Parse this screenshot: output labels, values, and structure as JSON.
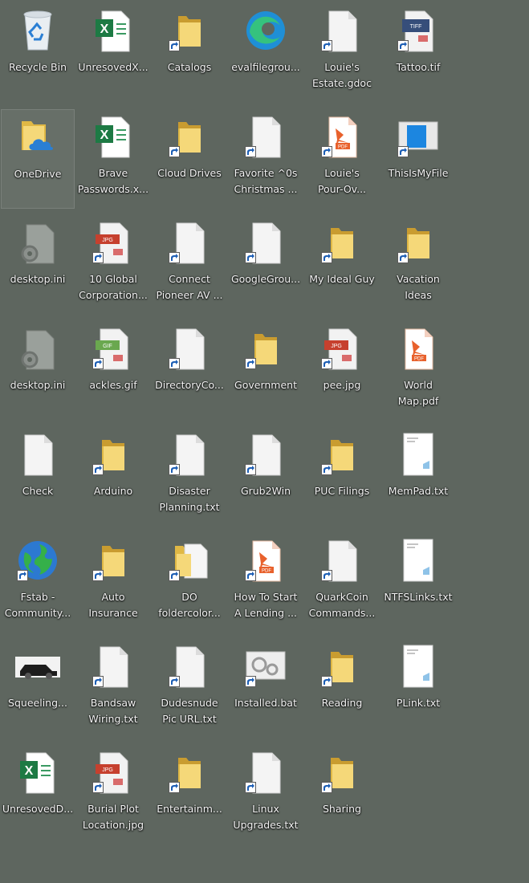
{
  "desktop": {
    "icons": [
      {
        "label": "Recycle Bin",
        "type": "recycle",
        "icon": "recycle-bin-icon",
        "shortcut": false,
        "name": "recycle-bin"
      },
      {
        "label": "UnresovedX...",
        "type": "excel",
        "icon": "excel-icon",
        "shortcut": false,
        "name": "unresovedx"
      },
      {
        "label": "Catalogs",
        "type": "folder",
        "icon": "folder-icon",
        "shortcut": true,
        "name": "catalogs"
      },
      {
        "label": "evalfilegrou...",
        "type": "edge",
        "icon": "edge-icon",
        "shortcut": false,
        "name": "evalfilegroup"
      },
      {
        "label": "Louie's\nEstate.gdoc",
        "type": "doc",
        "icon": "document-icon",
        "shortcut": true,
        "name": "louies-estate-gdoc"
      },
      {
        "label": "Tattoo.tif",
        "type": "tif",
        "icon": "tif-image-icon",
        "shortcut": true,
        "name": "tattoo-tif"
      },
      {
        "label": "OneDrive",
        "type": "onedrive",
        "icon": "onedrive-folder-icon",
        "shortcut": false,
        "name": "onedrive",
        "selected": true
      },
      {
        "label": "Brave\nPasswords.x...",
        "type": "excel",
        "icon": "excel-icon",
        "shortcut": false,
        "name": "brave-passwords"
      },
      {
        "label": "Cloud Drives",
        "type": "folder",
        "icon": "folder-icon",
        "shortcut": true,
        "name": "cloud-drives"
      },
      {
        "label": "Favorite ^0s\nChristmas ...",
        "type": "doc",
        "icon": "document-icon",
        "shortcut": true,
        "name": "favorite-christmas"
      },
      {
        "label": "Louie's\nPour-Ov...",
        "type": "pdf",
        "icon": "pdf-icon",
        "shortcut": true,
        "name": "louies-pour-over"
      },
      {
        "label": "ThisIsMyFile",
        "type": "window",
        "icon": "window-icon",
        "shortcut": true,
        "name": "thisismyfile"
      },
      {
        "label": "desktop.ini",
        "type": "ini",
        "icon": "settings-file-icon",
        "shortcut": false,
        "name": "desktop-ini-1"
      },
      {
        "label": "10 Global\nCorporation...",
        "type": "image",
        "icon": "image-file-icon",
        "shortcut": true,
        "name": "global-corporation"
      },
      {
        "label": "Connect\nPioneer AV ...",
        "type": "doc",
        "icon": "document-icon",
        "shortcut": true,
        "name": "connect-pioneer"
      },
      {
        "label": "GoogleGrou...",
        "type": "doc",
        "icon": "document-icon",
        "shortcut": true,
        "name": "googlegroups"
      },
      {
        "label": "My Ideal Guy",
        "type": "folder",
        "icon": "folder-icon",
        "shortcut": true,
        "name": "my-ideal-guy"
      },
      {
        "label": "Vacation\nIdeas",
        "type": "folder",
        "icon": "folder-icon",
        "shortcut": true,
        "name": "vacation-ideas"
      },
      {
        "label": "desktop.ini",
        "type": "ini",
        "icon": "settings-file-icon",
        "shortcut": false,
        "name": "desktop-ini-2"
      },
      {
        "label": "ackles.gif",
        "type": "gif",
        "icon": "gif-file-icon",
        "shortcut": true,
        "name": "ackles-gif"
      },
      {
        "label": "DirectoryCo...",
        "type": "doc",
        "icon": "document-icon",
        "shortcut": true,
        "name": "directoryco"
      },
      {
        "label": "Government",
        "type": "folder",
        "icon": "folder-icon",
        "shortcut": true,
        "name": "government"
      },
      {
        "label": "pee.jpg",
        "type": "image",
        "icon": "image-file-icon",
        "shortcut": true,
        "name": "pee-jpg"
      },
      {
        "label": "World\nMap.pdf",
        "type": "pdf",
        "icon": "pdf-icon",
        "shortcut": false,
        "name": "world-map-pdf"
      },
      {
        "label": "Check",
        "type": "doc",
        "icon": "document-icon",
        "shortcut": false,
        "name": "check"
      },
      {
        "label": "Arduino",
        "type": "folder",
        "icon": "folder-icon",
        "shortcut": true,
        "name": "arduino"
      },
      {
        "label": "Disaster\nPlanning.txt",
        "type": "doc",
        "icon": "document-icon",
        "shortcut": true,
        "name": "disaster-planning"
      },
      {
        "label": "Grub2Win",
        "type": "doc",
        "icon": "document-icon",
        "shortcut": true,
        "name": "grub2win"
      },
      {
        "label": "PUC Filings",
        "type": "folder",
        "icon": "folder-icon",
        "shortcut": true,
        "name": "puc-filings"
      },
      {
        "label": "MemPad.txt",
        "type": "txt",
        "icon": "text-file-icon",
        "shortcut": false,
        "name": "mempad-txt"
      },
      {
        "label": "Fstab -\nCommunity...",
        "type": "globe",
        "icon": "globe-icon",
        "shortcut": true,
        "name": "fstab-community"
      },
      {
        "label": "Auto\nInsurance",
        "type": "folder",
        "icon": "folder-icon",
        "shortcut": true,
        "name": "auto-insurance"
      },
      {
        "label": "DO\nfoldercolor...",
        "type": "folderdoc",
        "icon": "folder-document-icon",
        "shortcut": true,
        "name": "do-foldercolor"
      },
      {
        "label": "How To Start\nA Lending ...",
        "type": "pdf",
        "icon": "pdf-icon",
        "shortcut": true,
        "name": "how-to-start-lending"
      },
      {
        "label": "QuarkCoin\nCommands...",
        "type": "doc",
        "icon": "document-icon",
        "shortcut": true,
        "name": "quarkcoin-commands"
      },
      {
        "label": "NTFSLinks.txt",
        "type": "txt",
        "icon": "text-file-icon",
        "shortcut": false,
        "name": "ntfslinks-txt"
      },
      {
        "label": "Squeeling...",
        "type": "photo",
        "icon": "car-photo-icon",
        "shortcut": false,
        "name": "squeeling"
      },
      {
        "label": "Bandsaw\nWiring.txt",
        "type": "doc",
        "icon": "document-icon",
        "shortcut": true,
        "name": "bandsaw-wiring"
      },
      {
        "label": "Dudesnude\nPic URL.txt",
        "type": "doc",
        "icon": "document-icon",
        "shortcut": true,
        "name": "dudesnude-pic-url"
      },
      {
        "label": "Installed.bat",
        "type": "bat",
        "icon": "batch-file-icon",
        "shortcut": true,
        "name": "installed-bat"
      },
      {
        "label": "Reading",
        "type": "folder",
        "icon": "folder-icon",
        "shortcut": true,
        "name": "reading"
      },
      {
        "label": "PLink.txt",
        "type": "txt",
        "icon": "text-file-icon",
        "shortcut": false,
        "name": "plink-txt"
      },
      {
        "label": "UnresovedD...",
        "type": "excel",
        "icon": "excel-icon",
        "shortcut": false,
        "name": "unresovedd"
      },
      {
        "label": "Burial Plot\nLocation.jpg",
        "type": "image",
        "icon": "image-file-icon",
        "shortcut": true,
        "name": "burial-plot-location"
      },
      {
        "label": "Entertainm...",
        "type": "folder",
        "icon": "folder-icon",
        "shortcut": true,
        "name": "entertainment"
      },
      {
        "label": "Linux\nUpgrades.txt",
        "type": "doc",
        "icon": "document-icon",
        "shortcut": true,
        "name": "linux-upgrades"
      },
      {
        "label": "Sharing",
        "type": "folder",
        "icon": "folder-icon",
        "shortcut": true,
        "name": "sharing"
      }
    ]
  }
}
